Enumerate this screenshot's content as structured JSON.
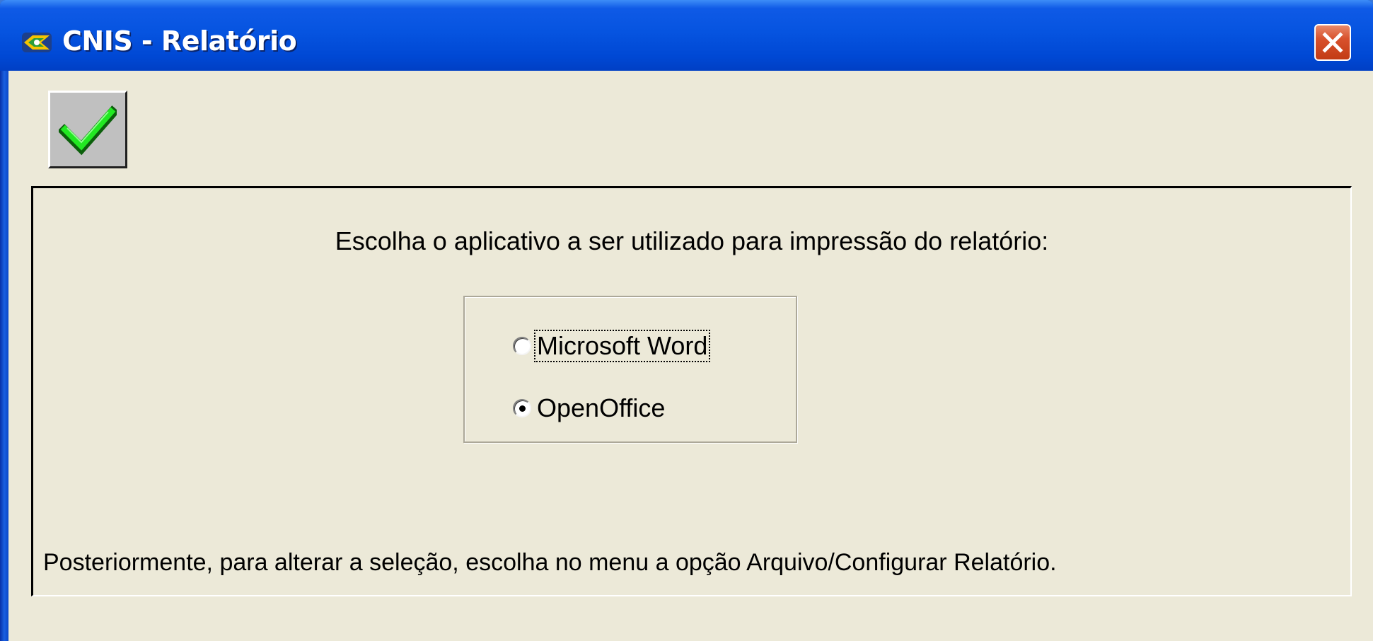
{
  "window": {
    "title": "CNIS - Relatório",
    "app_icon": "cnis-app-icon",
    "close_icon": "close-icon"
  },
  "toolbar": {
    "ok_icon": "checkmark-icon"
  },
  "dialog": {
    "prompt": "Escolha o aplicativo a ser utilizado para impressão do relatório:",
    "options": [
      {
        "label": "Microsoft Word",
        "selected": false,
        "focused": true
      },
      {
        "label": "OpenOffice",
        "selected": true,
        "focused": false
      }
    ],
    "footnote": "Posteriormente, para alterar a seleção, escolha no menu a opção Arquivo/Configurar Relatório."
  },
  "colors": {
    "titlebar": "#0654e0",
    "client_bg": "#ece9d8",
    "close_button": "#d8512c",
    "check_green": "#22e822"
  }
}
